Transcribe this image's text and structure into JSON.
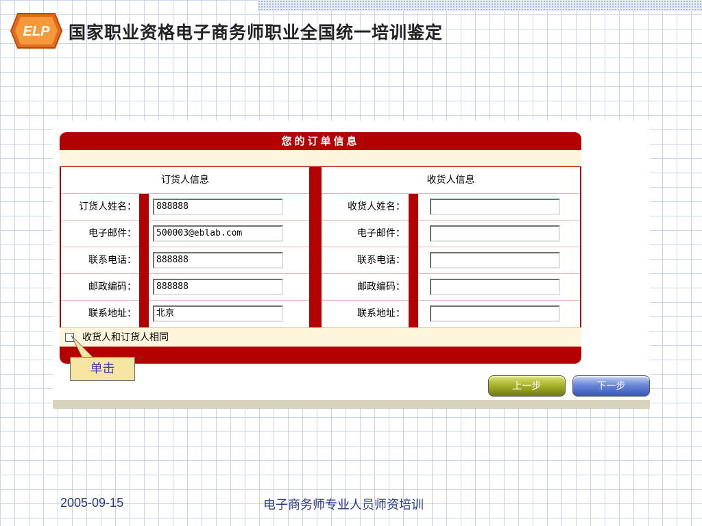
{
  "slide": {
    "title": "国家职业资格电子商务师职业全国统一培训鉴定",
    "logo_text": "ELP",
    "footer_date": "2005-09-15",
    "footer_caption": "电子商务师专业人员师资培训"
  },
  "order": {
    "header": "您的订单信息",
    "orderer": {
      "heading": "订货人信息",
      "fields": [
        {
          "label": "订货人姓名：",
          "value": "888888"
        },
        {
          "label": "电子邮件：",
          "value": "500003@eblab.com"
        },
        {
          "label": "联系电话：",
          "value": "888888"
        },
        {
          "label": "邮政编码：",
          "value": "888888"
        },
        {
          "label": "联系地址：",
          "value": "北京"
        }
      ]
    },
    "receiver": {
      "heading": "收货人信息",
      "fields": [
        {
          "label": "收货人姓名：",
          "value": ""
        },
        {
          "label": "电子邮件：",
          "value": ""
        },
        {
          "label": "联系电话：",
          "value": ""
        },
        {
          "label": "邮政编码：",
          "value": ""
        },
        {
          "label": "联系地址：",
          "value": ""
        }
      ]
    },
    "same_checkbox_label": "收货人和订货人相同",
    "same_checked": false
  },
  "callout": {
    "text": "单击"
  },
  "buttons": {
    "prev": "上一步",
    "next": "下一步"
  },
  "colors": {
    "panel_red": "#b30000",
    "cream": "#fdf6dc",
    "callout_bg": "#f6e5a3"
  }
}
